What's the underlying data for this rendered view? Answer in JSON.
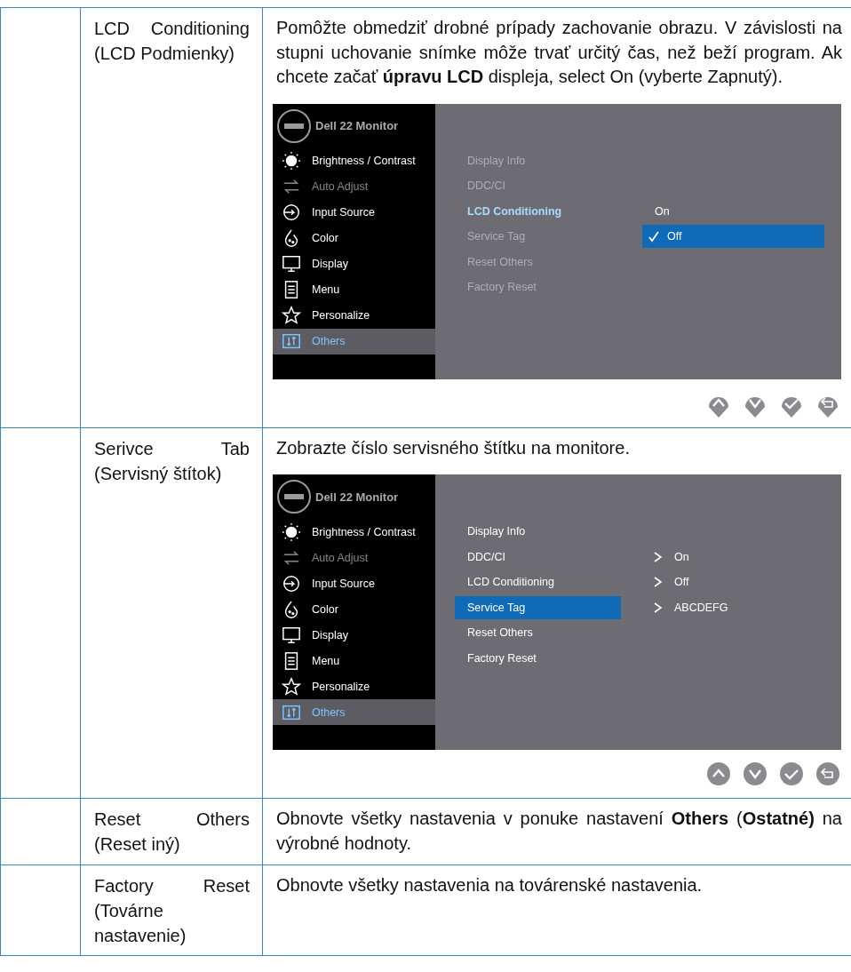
{
  "rows": [
    {
      "label": "LCD Conditioning (LCD Podmienky)",
      "description": "Pomôžte obmedziť drobné prípady zachovanie obrazu. V závislosti na stupni uchovanie snímke môže trvať určitý čas, než beží program. Ak chcete začať **úpravu LCD** displeja, select On (vyberte Zapnutý).",
      "osd": {
        "title": "Dell 22 Monitor",
        "menu": [
          {
            "label": "Brightness / Contrast",
            "kind": "brightness",
            "dimmed": false,
            "selected": false
          },
          {
            "label": "Auto Adjust",
            "kind": "auto-adjust",
            "dimmed": true,
            "selected": false
          },
          {
            "label": "Input Source",
            "kind": "input-source",
            "dimmed": false,
            "selected": false
          },
          {
            "label": "Color",
            "kind": "color",
            "dimmed": false,
            "selected": false
          },
          {
            "label": "Display",
            "kind": "display",
            "dimmed": false,
            "selected": false
          },
          {
            "label": "Menu",
            "kind": "menu",
            "dimmed": false,
            "selected": false
          },
          {
            "label": "Personalize",
            "kind": "personalize",
            "dimmed": false,
            "selected": false
          },
          {
            "label": "Others",
            "kind": "others",
            "dimmed": false,
            "selected": true
          }
        ],
        "submenu": [
          {
            "label": "Display Info",
            "dimmed": true,
            "highlighted": false,
            "selected": false
          },
          {
            "label": "DDC/CI",
            "dimmed": true,
            "highlighted": false,
            "selected": false
          },
          {
            "label": "LCD Conditioning",
            "dimmed": false,
            "highlighted": true,
            "selected": false,
            "option": {
              "label": "On",
              "selected": false
            }
          },
          {
            "label": "Service Tag",
            "dimmed": true,
            "highlighted": false,
            "selected": false,
            "option": {
              "label": "Off",
              "selected": true
            }
          },
          {
            "label": "Reset Others",
            "dimmed": true,
            "highlighted": false,
            "selected": false
          },
          {
            "label": "Factory Reset",
            "dimmed": true,
            "highlighted": false,
            "selected": false
          }
        ],
        "nav": [
          {
            "kind": "pin"
          },
          {
            "kind": "pin"
          },
          {
            "kind": "pin"
          },
          {
            "kind": "pin"
          }
        ]
      }
    },
    {
      "label": "Serivce Tab (Servisný štítok)",
      "description": "Zobrazte číslo servisného štítku na monitore.",
      "osd": {
        "title": "Dell 22 Monitor",
        "menu": [
          {
            "label": "Brightness / Contrast",
            "kind": "brightness",
            "dimmed": false,
            "selected": false
          },
          {
            "label": "Auto Adjust",
            "kind": "auto-adjust",
            "dimmed": true,
            "selected": false
          },
          {
            "label": "Input Source",
            "kind": "input-source",
            "dimmed": false,
            "selected": false
          },
          {
            "label": "Color",
            "kind": "color",
            "dimmed": false,
            "selected": false
          },
          {
            "label": "Display",
            "kind": "display",
            "dimmed": false,
            "selected": false
          },
          {
            "label": "Menu",
            "kind": "menu",
            "dimmed": false,
            "selected": false
          },
          {
            "label": "Personalize",
            "kind": "personalize",
            "dimmed": false,
            "selected": false
          },
          {
            "label": "Others",
            "kind": "others",
            "dimmed": false,
            "selected": true
          }
        ],
        "submenu": [
          {
            "label": "Display Info",
            "dimmed": false,
            "highlighted": false,
            "selected": false
          },
          {
            "label": "DDC/CI",
            "dimmed": false,
            "highlighted": false,
            "selected": false,
            "value": "On"
          },
          {
            "label": "LCD Conditioning",
            "dimmed": false,
            "highlighted": false,
            "selected": false,
            "value": "Off"
          },
          {
            "label": "Service Tag",
            "dimmed": false,
            "highlighted": false,
            "selected": true,
            "value": "ABCDEFG"
          },
          {
            "label": "Reset Others",
            "dimmed": false,
            "highlighted": false,
            "selected": false
          },
          {
            "label": "Factory Reset",
            "dimmed": false,
            "highlighted": false,
            "selected": false
          }
        ],
        "nav": [
          {
            "kind": "circle"
          },
          {
            "kind": "circle"
          },
          {
            "kind": "circle"
          },
          {
            "kind": "circle"
          }
        ]
      }
    },
    {
      "label": "Reset Others (Reset iný)",
      "description": "Obnovte všetky nastavenia v ponuke nastavení **Others** (**Ostatné)** na výrobné hodnoty."
    },
    {
      "label": "Factory Reset (Továrne nastavenie)",
      "description": "Obnovte všetky nastavenia na továrenské nastavenia."
    }
  ]
}
